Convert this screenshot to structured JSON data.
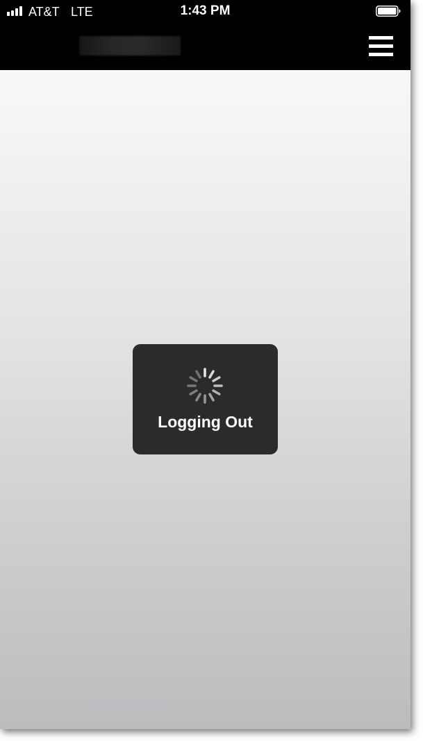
{
  "status_bar": {
    "carrier": "AT&T",
    "network": "LTE",
    "time": "1:43 PM",
    "signal_bars": 4,
    "battery_level": 1.0
  },
  "nav_bar": {
    "title_obscured": true,
    "menu_icon": "hamburger-menu-icon"
  },
  "hud": {
    "label": "Logging Out",
    "icon": "activity-spinner-icon"
  },
  "colors": {
    "bar_background": "#000000",
    "hud_background": "#2b2b2b",
    "hud_text": "#ffffff"
  }
}
